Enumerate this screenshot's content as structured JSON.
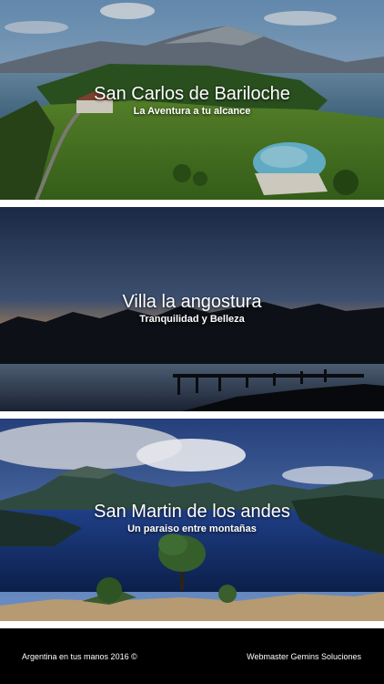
{
  "cards": [
    {
      "title": "San Carlos de Bariloche",
      "subtitle": "La Aventura a tu alcance"
    },
    {
      "title": "Villa la angostura",
      "subtitle": "Tranquilidad y Belleza"
    },
    {
      "title": "San Martin de los andes",
      "subtitle": "Un paraiso entre montañas"
    }
  ],
  "footer": {
    "copyright": "Argentina en tus manos 2016 ©",
    "credit": "Webmaster Gemins Soluciones"
  },
  "colors": {
    "footer_bg": "#000000",
    "text": "#ffffff"
  }
}
